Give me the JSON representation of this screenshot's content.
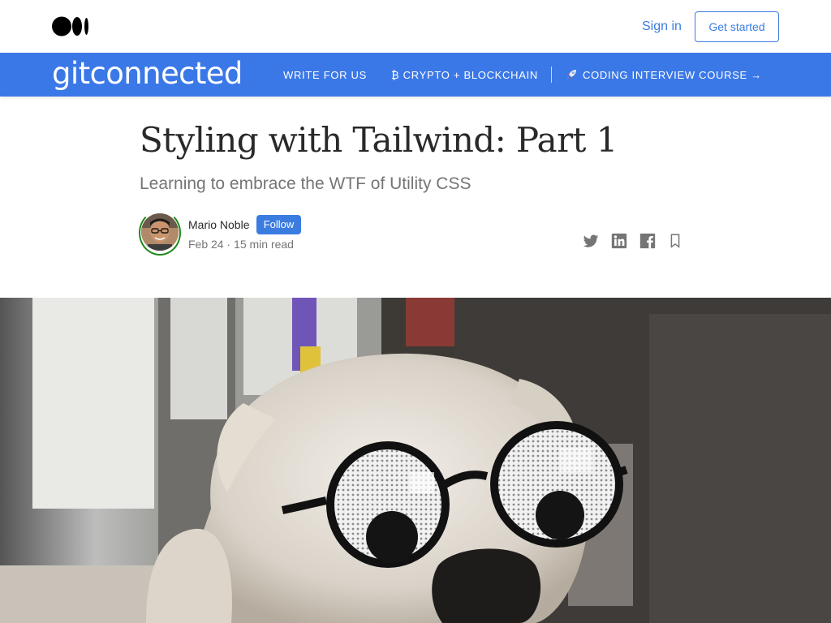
{
  "topbar": {
    "signin_label": "Sign in",
    "getstarted_label": "Get started"
  },
  "publication": {
    "name": "gitconnected",
    "nav": [
      {
        "label": "WRITE FOR US"
      },
      {
        "label": "₿ CRYPTO + BLOCKCHAIN"
      },
      {
        "label": "CODING INTERVIEW COURSE →",
        "icon": "rocket-icon"
      }
    ]
  },
  "article": {
    "title": "Styling with Tailwind: Part 1",
    "subtitle": "Learning to embrace the WTF of Utility CSS",
    "author": "Mario Noble",
    "follow_label": "Follow",
    "meta": "Feb 24 · 15 min read"
  },
  "share_icons": [
    "twitter-icon",
    "linkedin-icon",
    "facebook-icon",
    "bookmark-icon"
  ],
  "colors": {
    "accent": "#3b7ce0",
    "pub_bar": "#3b78e7",
    "ring": "#1a8917"
  },
  "hero": {
    "alt": "dog wearing googly eye glasses"
  }
}
